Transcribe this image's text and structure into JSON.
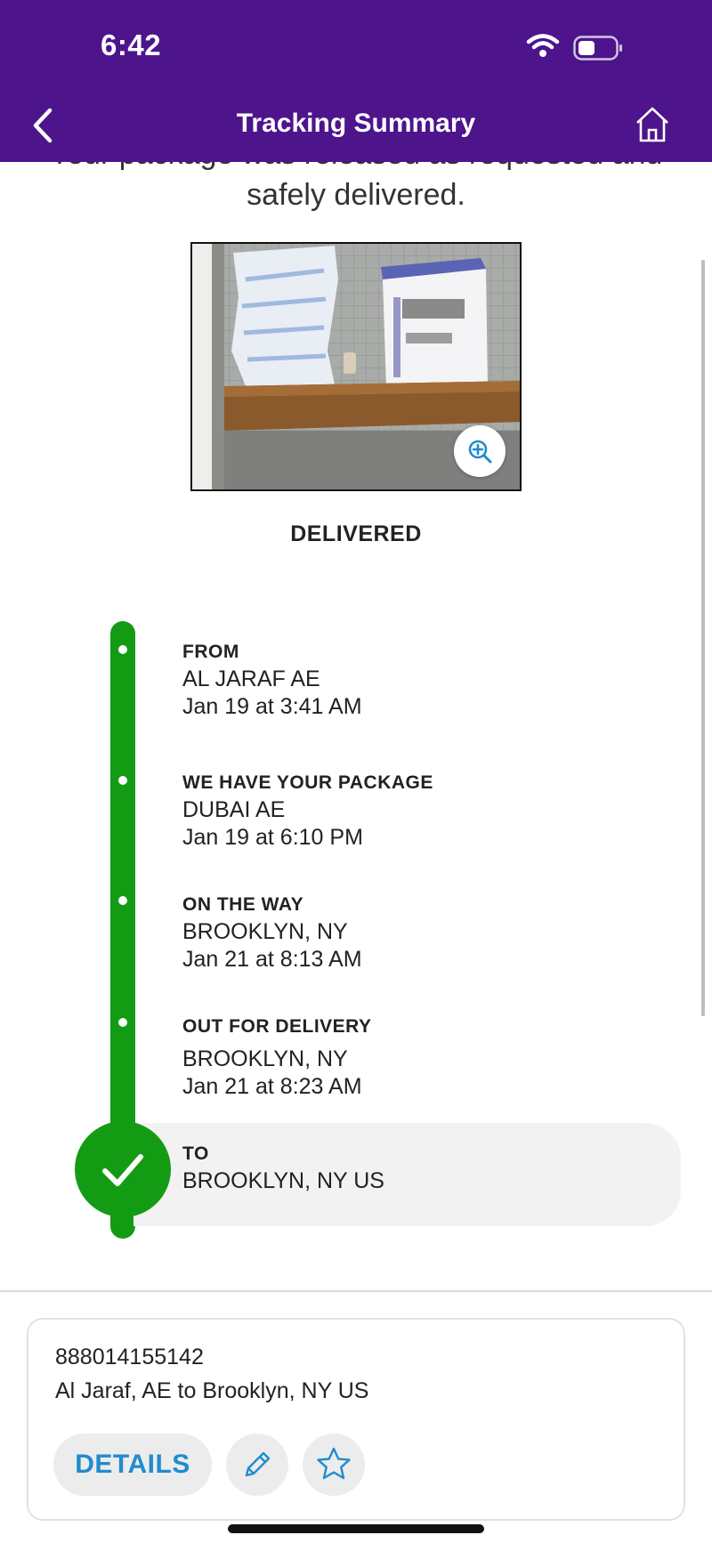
{
  "status_bar": {
    "time": "6:42"
  },
  "header": {
    "title": "Tracking Summary"
  },
  "message": "Your package was released as requested and safely delivered.",
  "status": "DELIVERED",
  "timeline": [
    {
      "title": "FROM",
      "location": "AL JARAF AE",
      "time": "Jan 19 at 3:41 AM"
    },
    {
      "title": "WE HAVE YOUR PACKAGE",
      "location": "DUBAI AE",
      "time": "Jan 19 at 6:10 PM"
    },
    {
      "title": "ON THE WAY",
      "location": "BROOKLYN, NY",
      "time": "Jan 21 at 8:13 AM"
    },
    {
      "title": "OUT FOR DELIVERY",
      "location": "BROOKLYN, NY",
      "time": "Jan 21 at 8:23 AM"
    },
    {
      "title": "TO",
      "location": "BROOKLYN, NY  US"
    }
  ],
  "summary": {
    "tracking_number": "888014155142",
    "route": "Al Jaraf, AE to Brooklyn, NY US",
    "details_label": "DETAILS"
  },
  "icons": {
    "back": "chevron-left-icon",
    "home": "home-icon",
    "zoom": "zoom-in-icon",
    "check": "checkmark-icon",
    "edit": "pencil-icon",
    "favorite": "star-icon"
  },
  "colors": {
    "header": "#4d148c",
    "progress": "#149b14",
    "accent": "#1f8ccf"
  }
}
